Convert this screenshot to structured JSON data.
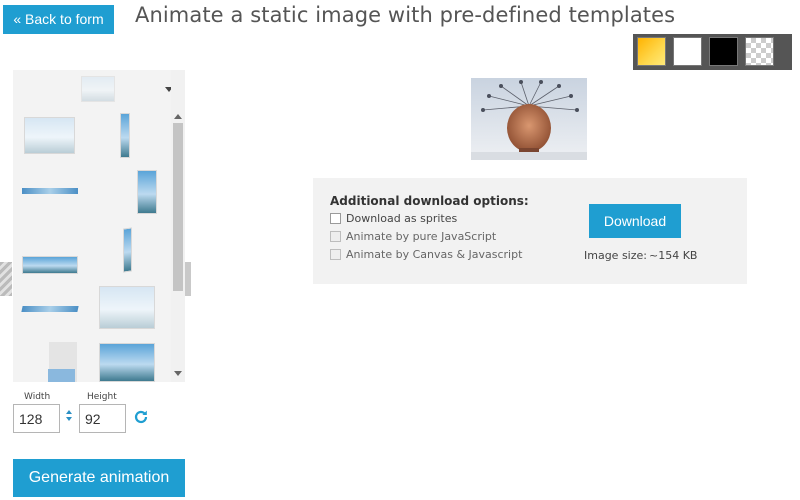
{
  "header": {
    "back_label": "« Back to form",
    "title": "Animate a static image with pre-defined templates"
  },
  "background_swatches": [
    {
      "name": "yellow-gradient",
      "color": "#ffc21a"
    },
    {
      "name": "white",
      "color": "#ffffff"
    },
    {
      "name": "black",
      "color": "#000000"
    },
    {
      "name": "transparent",
      "color": "checkerboard"
    }
  ],
  "dimensions": {
    "width_label": "Width",
    "width_value": "128",
    "height_label": "Height",
    "height_value": "92"
  },
  "actions": {
    "generate_label": "Generate animation"
  },
  "download_options": {
    "title": "Additional download options:",
    "options": [
      {
        "label": "Download as sprites",
        "checked": false,
        "enabled": true
      },
      {
        "label": "Animate by pure JavaScript",
        "checked": false,
        "enabled": false
      },
      {
        "label": "Animate by Canvas & Javascript",
        "checked": false,
        "enabled": false
      }
    ],
    "download_label": "Download",
    "size_label": "Image size:",
    "size_value": "~154 KB"
  },
  "colors": {
    "accent": "#1f9ed1",
    "options_bg": "#f2f2f2",
    "swatch_bar": "#555555"
  }
}
